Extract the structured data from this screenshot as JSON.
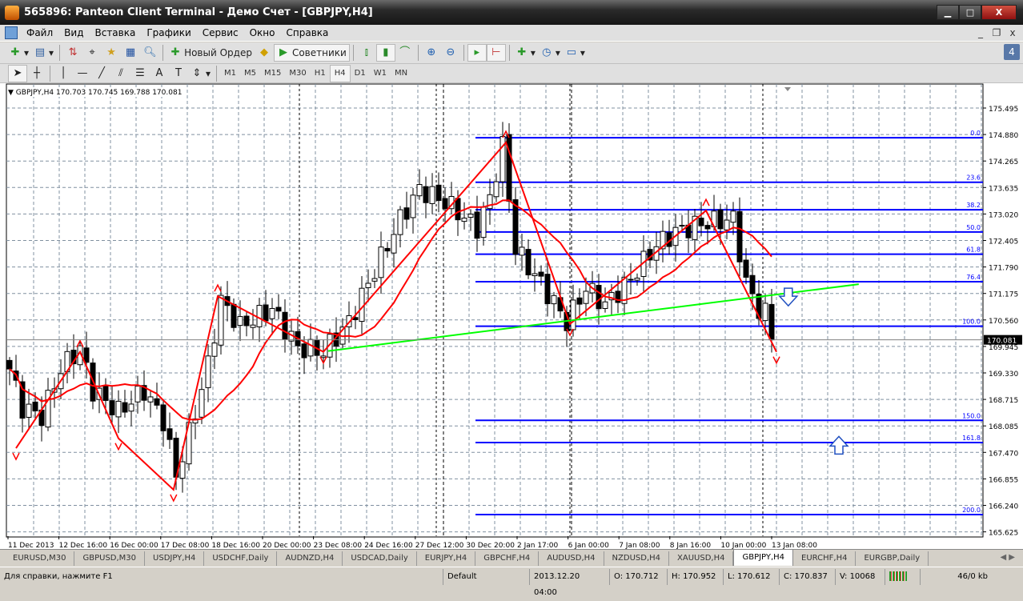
{
  "window": {
    "title": "565896: Panteon Client Terminal - Демо Счет - [GBPJPY,H4]",
    "minimize": "▁",
    "maximize": "□",
    "close": "X"
  },
  "menu": [
    "Файл",
    "Вид",
    "Вставка",
    "Графики",
    "Сервис",
    "Окно",
    "Справка"
  ],
  "mdi": {
    "minimize": "_",
    "restore": "❐",
    "close": "x"
  },
  "toolbar": {
    "new_order": "Новый Ордер",
    "experts": "Советники",
    "notifications": "4"
  },
  "timeframes": [
    "M1",
    "M5",
    "M15",
    "M30",
    "H1",
    "H4",
    "D1",
    "W1",
    "MN"
  ],
  "active_timeframe": "H4",
  "chart": {
    "header": "GBPJPY,H4  170.703 170.745 169.788 170.081",
    "current_price": "170.081"
  },
  "chart_data": {
    "type": "candlestick",
    "symbol": "GBPJPY",
    "timeframe": "H4",
    "ylim": [
      165.625,
      175.495
    ],
    "price_ticks": [
      "175.495",
      "174.880",
      "174.265",
      "173.635",
      "173.020",
      "172.405",
      "171.790",
      "171.175",
      "170.560",
      "169.945",
      "169.330",
      "168.715",
      "168.085",
      "167.470",
      "166.855",
      "166.240",
      "165.625"
    ],
    "date_ticks": [
      "11 Dec 2013",
      "12 Dec 16:00",
      "16 Dec 00:00",
      "17 Dec 08:00",
      "18 Dec 16:00",
      "20 Dec 00:00",
      "23 Dec 08:00",
      "24 Dec 16:00",
      "27 Dec 12:00",
      "30 Dec 20:00",
      "2 Jan 17:00",
      "6 Jan 00:00",
      "7 Jan 08:00",
      "8 Jan 16:00",
      "10 Jan 00:00",
      "13 Jan 08:00"
    ],
    "bars": 120,
    "close_keypoints": [
      [
        0,
        169.4
      ],
      [
        2,
        168.5
      ],
      [
        5,
        168.3
      ],
      [
        8,
        169.4
      ],
      [
        11,
        169.9
      ],
      [
        13,
        168.9
      ],
      [
        17,
        168.4
      ],
      [
        21,
        168.9
      ],
      [
        24,
        168.2
      ],
      [
        26,
        166.9
      ],
      [
        29,
        168.4
      ],
      [
        31,
        169.5
      ],
      [
        33,
        171.0
      ],
      [
        36,
        170.4
      ],
      [
        41,
        170.8
      ],
      [
        45,
        169.9
      ],
      [
        49,
        169.8
      ],
      [
        53,
        170.5
      ],
      [
        57,
        171.7
      ],
      [
        61,
        172.9
      ],
      [
        64,
        173.6
      ],
      [
        68,
        173.3
      ],
      [
        73,
        172.7
      ],
      [
        75,
        173.4
      ],
      [
        77,
        174.6
      ],
      [
        79,
        172.2
      ],
      [
        83,
        171.4
      ],
      [
        87,
        170.5
      ],
      [
        90,
        171.3
      ],
      [
        93,
        170.9
      ],
      [
        97,
        171.5
      ],
      [
        101,
        172.3
      ],
      [
        104,
        172.6
      ],
      [
        108,
        172.8
      ],
      [
        113,
        172.9
      ],
      [
        115,
        171.4
      ],
      [
        117,
        170.8
      ],
      [
        118,
        170.7
      ],
      [
        119,
        170.081
      ]
    ],
    "zigzag": [
      [
        1,
        167.55
      ],
      [
        11,
        169.8
      ],
      [
        17,
        167.78
      ],
      [
        25.6,
        166.58
      ],
      [
        32.5,
        171.1
      ],
      [
        49,
        169.8
      ],
      [
        77.5,
        174.69
      ],
      [
        87.5,
        170.45
      ],
      [
        108.75,
        173.1
      ],
      [
        119.75,
        169.8
      ]
    ],
    "ma_period": 13,
    "trendline": [
      [
        49.75,
        169.82
      ],
      [
        132.6,
        171.38
      ]
    ],
    "fibonacci": {
      "start_bar": 73,
      "price_0": 174.8,
      "price_100": 170.4,
      "levels": [
        "0.0",
        "23.6",
        "38.2",
        "50.0",
        "61.8",
        "76.4",
        "100.0",
        "150.0",
        "161.8",
        "200.0"
      ]
    },
    "arrows": [
      {
        "dir": "down",
        "bar": 121.6,
        "price": 171.1
      },
      {
        "dir": "up",
        "bar": 129.5,
        "price": 167.6
      }
    ],
    "colors": {
      "bull": "#ffffff",
      "bear": "#000000",
      "zigzag": "#ff0000",
      "ma": "#ff0000",
      "fib": "#0000ff",
      "trend": "#00ff00",
      "arrow": "#2050c0"
    }
  },
  "tabs": [
    "EURUSD,M30",
    "GBPUSD,M30",
    "USDJPY,H4",
    "USDCHF,Daily",
    "AUDNZD,H4",
    "USDCAD,Daily",
    "EURJPY,H4",
    "GBPCHF,H4",
    "AUDUSD,H4",
    "NZDUSD,H4",
    "XAUUSD,H4",
    "GBPJPY,H4",
    "EURCHF,H4",
    "EURGBP,Daily"
  ],
  "active_tab": "GBPJPY,H4",
  "status": {
    "help": "Для справки, нажмите F1",
    "profile": "Default",
    "time": "2013.12.20 04:00",
    "open": "O: 170.712",
    "high": "H: 170.952",
    "low": "L: 170.612",
    "close": "C: 170.837",
    "volume": "V: 10068",
    "traffic": "46/0 kb"
  }
}
